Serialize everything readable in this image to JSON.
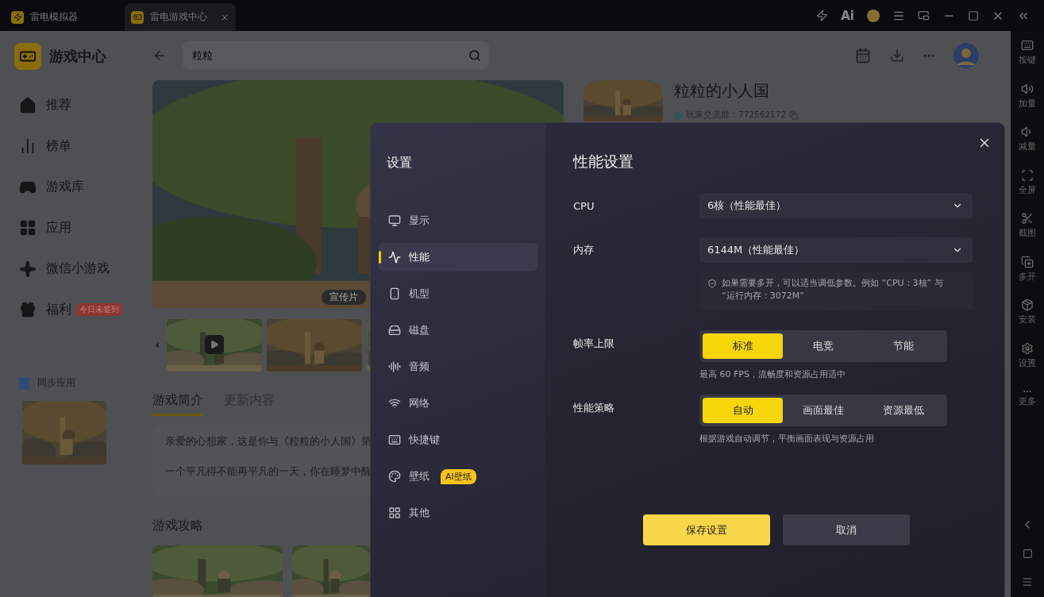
{
  "titlebar": {
    "tabs": [
      {
        "label": "雷电模拟器",
        "selected": false
      },
      {
        "label": "雷电游戏中心",
        "selected": true
      }
    ],
    "ai_label": "Ai"
  },
  "sidebar": {
    "title": "游戏中心",
    "items": [
      {
        "label": "推荐"
      },
      {
        "label": "榜单"
      },
      {
        "label": "游戏库"
      },
      {
        "label": "应用"
      },
      {
        "label": "微信小游戏"
      },
      {
        "label": "福利",
        "badge": "今日未签到"
      }
    ],
    "sync_label": "同步应用"
  },
  "header": {
    "search": {
      "value": "粒粒"
    }
  },
  "media": {
    "tag": "宣传片"
  },
  "game": {
    "title": "粒粒的小人国",
    "group": "玩家交流群：772562172"
  },
  "detail_tabs": [
    {
      "label": "游戏简介",
      "selected": true
    },
    {
      "label": "更新内容",
      "selected": false
    }
  ],
  "intro": [
    "亲爱的心想家，这是你与《粒粒的小人国》第",
    "一个平凡得不能再平凡的一天，你在睡梦中醒"
  ],
  "guides": {
    "title": "游戏攻略"
  },
  "rail": {
    "items": [
      {
        "label": "按键"
      },
      {
        "label": "加量"
      },
      {
        "label": "减量"
      },
      {
        "label": "全屏"
      },
      {
        "label": "截图"
      },
      {
        "label": "多开"
      },
      {
        "label": "安装"
      },
      {
        "label": "设置"
      },
      {
        "label": "更多"
      }
    ]
  },
  "dialog": {
    "nav_title": "设置",
    "nav": [
      {
        "label": "显示",
        "selected": false
      },
      {
        "label": "性能",
        "selected": true
      },
      {
        "label": "机型",
        "selected": false
      },
      {
        "label": "磁盘",
        "selected": false
      },
      {
        "label": "音频",
        "selected": false
      },
      {
        "label": "网络",
        "selected": false
      },
      {
        "label": "快捷键",
        "selected": false
      },
      {
        "label": "壁纸",
        "selected": false,
        "badge": "AI壁纸"
      },
      {
        "label": "其他",
        "selected": false
      }
    ],
    "title": "性能设置",
    "rows": [
      {
        "kind": "select",
        "label": "CPU",
        "value": "6核（性能最佳）"
      },
      {
        "kind": "select",
        "label": "内存",
        "value": "6144M（性能最佳）"
      },
      {
        "kind": "hint",
        "text": "如果需要多开，可以适当调低参数。例如 “CPU：3核” 与 “运行内存：3072M”"
      },
      {
        "kind": "segments",
        "label": "帧率上限",
        "options": [
          {
            "label": "标准",
            "selected": true
          },
          {
            "label": "电竞",
            "selected": false
          },
          {
            "label": "节能",
            "selected": false
          }
        ],
        "note": "最高 60 FPS，流畅度和资源占用适中"
      },
      {
        "kind": "segments",
        "label": "性能策略",
        "options": [
          {
            "label": "自动",
            "selected": true
          },
          {
            "label": "画面最佳",
            "selected": false
          },
          {
            "label": "资源最低",
            "selected": false
          }
        ],
        "note": "根据游戏自动调节，平衡画面表现与资源占用"
      }
    ],
    "buttons": [
      "保存设置",
      "取消"
    ]
  }
}
